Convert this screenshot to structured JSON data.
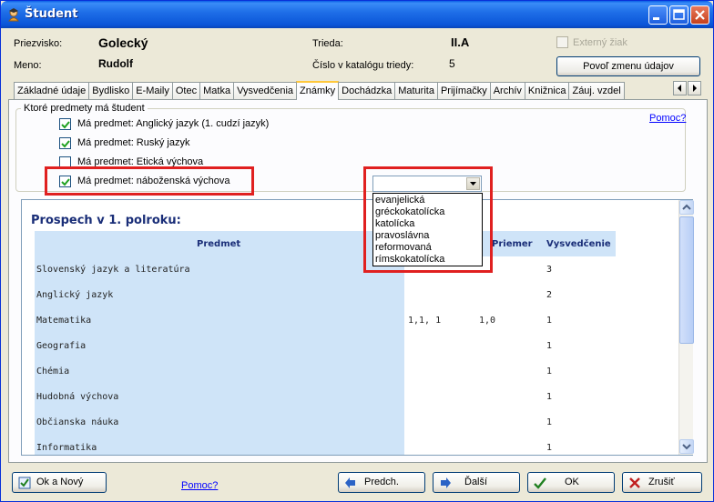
{
  "window": {
    "title": "Študent"
  },
  "header": {
    "surname_label": "Priezvisko:",
    "surname": "Golecký",
    "name_label": "Meno:",
    "name": "Rudolf",
    "class_label": "Trieda:",
    "class": "II.A",
    "catalog_label": "Číslo v katalógu triedy:",
    "catalog": "5",
    "external_label": "Externý žiak",
    "allow_edit_button": "Povoľ zmenu údajov"
  },
  "tabs": [
    "Základné údaje",
    "Bydlisko",
    "E-Maily",
    "Otec",
    "Matka",
    "Vysvedčenia",
    "Známky",
    "Dochádzka",
    "Maturita",
    "Prijímačky",
    "Archív",
    "Knižnica",
    "Záuj. vzdel"
  ],
  "subjects_group": {
    "title": "Ktoré predmety má študent",
    "help": "Pomoc?",
    "items": [
      {
        "label": "Má predmet: Anglický jazyk (1. cudzí jazyk)",
        "checked": true
      },
      {
        "label": "Má predmet: Ruský jazyk",
        "checked": true
      },
      {
        "label": "Má predmet: Etická výchova",
        "checked": false
      },
      {
        "label": "Má predmet: náboženská výchova",
        "checked": true
      }
    ]
  },
  "religion_combo": {
    "value": "",
    "options": [
      "evanjelická",
      "gréckokatolícka",
      "katolícka",
      "pravoslávna",
      "reformovaná",
      "rímskokatolícka"
    ]
  },
  "report": {
    "title": "Prospech v 1. polroku:",
    "columns": [
      "Predmet",
      "",
      "Priemer",
      "Vysvedčenie"
    ],
    "rows": [
      {
        "subject": "Slovenský jazyk a literatúra",
        "marks": "",
        "avg": "",
        "final": "3"
      },
      {
        "subject": "Anglický jazyk",
        "marks": "",
        "avg": "",
        "final": "2"
      },
      {
        "subject": "Matematika",
        "marks": "1,1, 1",
        "avg": "1,0",
        "final": "1"
      },
      {
        "subject": "Geografia",
        "marks": "",
        "avg": "",
        "final": "1"
      },
      {
        "subject": "Chémia",
        "marks": "",
        "avg": "",
        "final": "1"
      },
      {
        "subject": "Hudobná výchova",
        "marks": "",
        "avg": "",
        "final": "1"
      },
      {
        "subject": "Občianska náuka",
        "marks": "",
        "avg": "",
        "final": "1"
      },
      {
        "subject": "Informatika",
        "marks": "",
        "avg": "",
        "final": "1"
      }
    ]
  },
  "footer": {
    "ok_new": "Ok a Nový",
    "help": "Pomoc?",
    "prev": "Predch.",
    "next": "Ďalší",
    "ok": "OK",
    "cancel": "Zrušiť"
  },
  "colors": {
    "highlight_red": "#E02020",
    "title_blue": "#0B55D8",
    "table_blue": "#CFE4F8",
    "link": "#0000FF"
  }
}
